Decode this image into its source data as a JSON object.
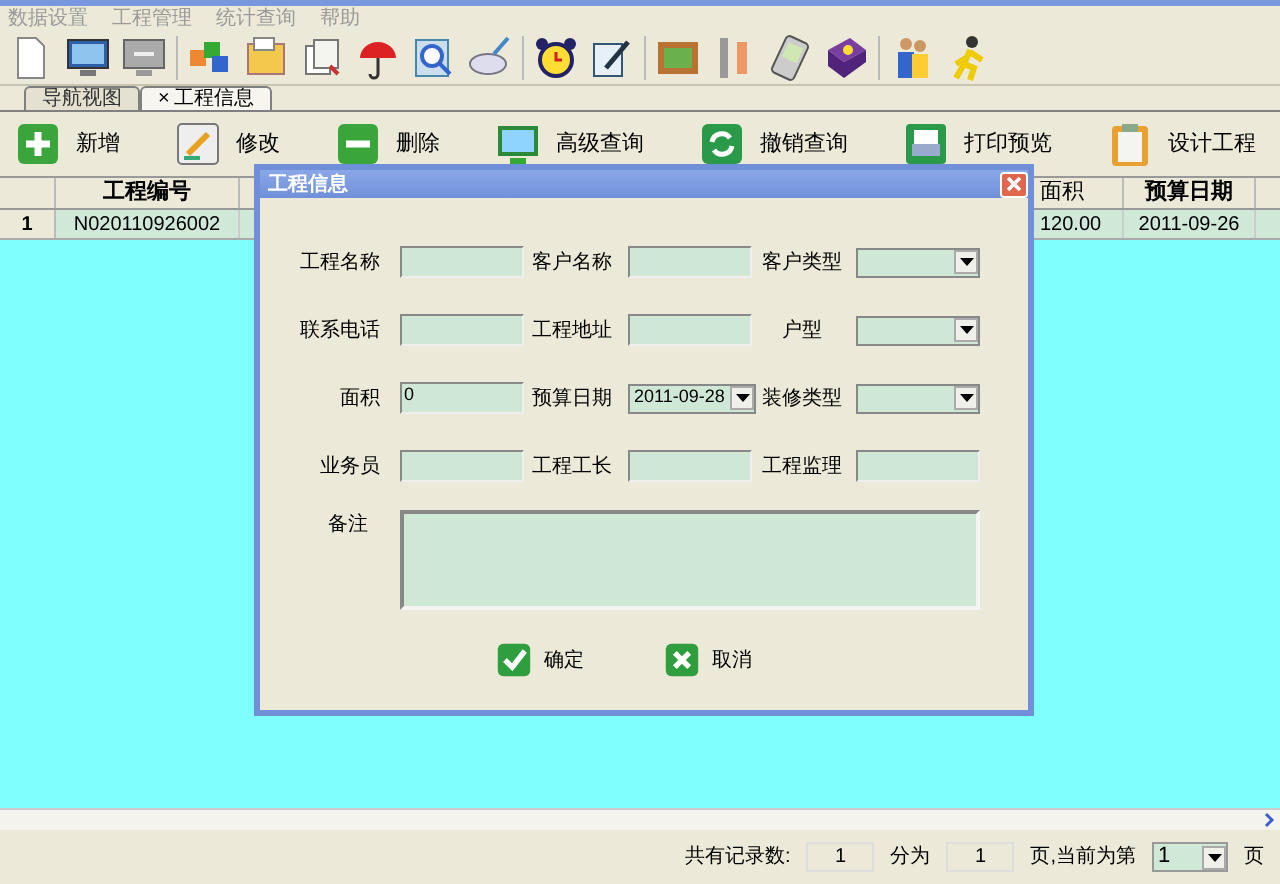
{
  "menu": [
    "数据设置",
    "工程管理",
    "统计查询",
    "帮助"
  ],
  "tabs": [
    {
      "label": "导航视图",
      "selected": false,
      "closable": false
    },
    {
      "label": "工程信息",
      "selected": true,
      "closable": true
    }
  ],
  "tab_close": "×",
  "actions": [
    "新增",
    "修改",
    "删除",
    "高级查询",
    "撤销查询",
    "打印预览",
    "设计工程"
  ],
  "table": {
    "columns": [
      "工程编号",
      "面积",
      "预算日期"
    ],
    "rows": [
      {
        "index": "1",
        "cells": [
          "N020110926002",
          "120.00",
          "2011-09-26"
        ]
      }
    ]
  },
  "dialog": {
    "title": "工程信息",
    "fields": [
      {
        "label": "工程名称",
        "kind": "text"
      },
      {
        "label": "客户名称",
        "kind": "text"
      },
      {
        "label": "客户类型",
        "kind": "combo"
      },
      {
        "label": "联系电话",
        "kind": "text"
      },
      {
        "label": "工程地址",
        "kind": "text"
      },
      {
        "label": "户型",
        "kind": "combo"
      },
      {
        "label": "面积",
        "kind": "text",
        "value": "0"
      },
      {
        "label": "预算日期",
        "kind": "date",
        "value": "2011-09-28"
      },
      {
        "label": "装修类型",
        "kind": "combo"
      },
      {
        "label": "业务员",
        "kind": "text"
      },
      {
        "label": "工程工长",
        "kind": "text"
      },
      {
        "label": "工程监理",
        "kind": "text"
      }
    ],
    "notes_label": "备注",
    "buttons": [
      "确定",
      "取消"
    ]
  },
  "status": {
    "total_label": "共有记录数:",
    "total": "1",
    "pages_label": "分为",
    "pages": "1",
    "current_label": "页,当前为第",
    "current": "1",
    "unit": "页"
  }
}
